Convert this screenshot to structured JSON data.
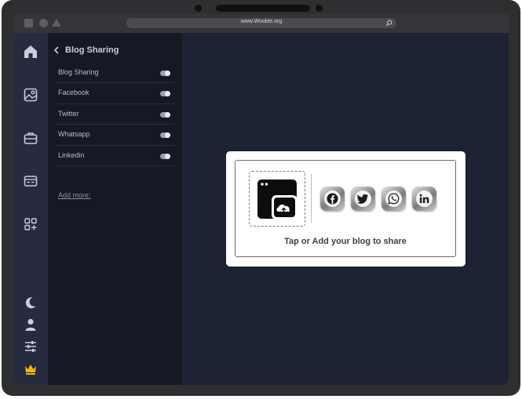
{
  "browser": {
    "url": "www.Wooble.org"
  },
  "rail": {
    "items": [
      {
        "icon": "home-icon"
      },
      {
        "icon": "image-icon"
      },
      {
        "icon": "briefcase-icon"
      },
      {
        "icon": "card-icon"
      },
      {
        "icon": "apps-add-icon"
      },
      {
        "icon": "moon-icon"
      },
      {
        "icon": "user-icon"
      },
      {
        "icon": "sliders-icon"
      },
      {
        "icon": "crown-icon"
      }
    ],
    "accent": "#f4b400"
  },
  "panel": {
    "title": "Blog Sharing",
    "items": [
      {
        "label": "Blog Sharing",
        "enabled": true
      },
      {
        "label": "Facebook",
        "enabled": true
      },
      {
        "label": "Twitter",
        "enabled": true
      },
      {
        "label": "Whatsapp",
        "enabled": true
      },
      {
        "label": "Linkedin",
        "enabled": true
      }
    ],
    "add_more": "Add more:"
  },
  "share_card": {
    "caption": "Tap or Add your blog to share",
    "upload_icon": "browser-upload-icon",
    "socials": [
      {
        "name": "facebook-icon"
      },
      {
        "name": "twitter-icon"
      },
      {
        "name": "whatsapp-icon"
      },
      {
        "name": "linkedin-icon"
      }
    ]
  },
  "colors": {
    "main_bg": "#1c2232",
    "rail_bg": "#252c3f",
    "panel_bg": "#151924",
    "card_bg": "#ffffff"
  }
}
